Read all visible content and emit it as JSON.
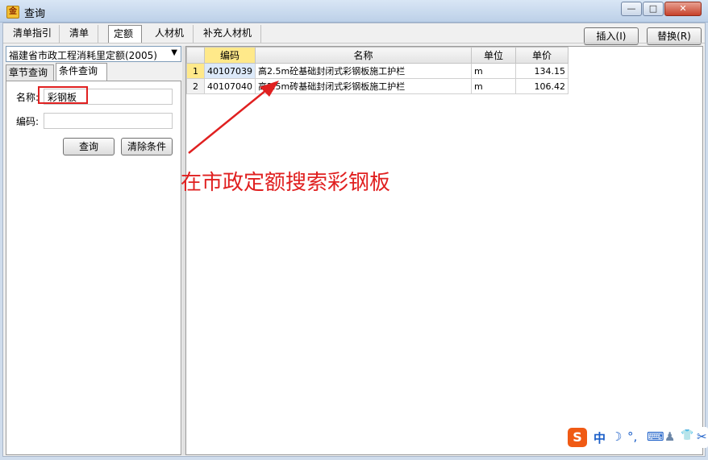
{
  "window": {
    "title": "查询",
    "app_icon": "金",
    "controls": {
      "minimize": "—",
      "maximize": "□",
      "close": "✕"
    }
  },
  "tabs": [
    "清单指引",
    "清单",
    "定额",
    "人材机",
    "补充人材机"
  ],
  "active_tab": "定额",
  "buttons": {
    "insert": "插入(I)",
    "replace": "替换(R)",
    "query": "查询",
    "clear": "清除条件"
  },
  "left": {
    "dropdown_value": "福建省市政工程消耗里定额(2005)",
    "dropdown_arrow": "▼",
    "subtabs": [
      "章节查询",
      "条件查询"
    ],
    "name_label": "名称:",
    "name_value": "彩钢板",
    "code_label": "编码:",
    "code_value": ""
  },
  "grid": {
    "columns": [
      "编码",
      "名称",
      "单位",
      "单价"
    ],
    "rows": [
      {
        "no": "1",
        "code": "40107039",
        "name": "高2.5m砼基础封闭式彩钢板施工护栏",
        "unit": "m",
        "price": "134.15"
      },
      {
        "no": "2",
        "code": "40107040",
        "name": "高2.5m砖基础封闭式彩钢板施工护栏",
        "unit": "m",
        "price": "106.42"
      }
    ]
  },
  "annotation": "在市政定额搜索彩钢板",
  "ime": {
    "logo": "S",
    "lang": "中",
    "moon": "☽",
    "punct": "°,",
    "keyboard": "⌨",
    "person": "♟",
    "shirt": "👕",
    "tools": "✂"
  },
  "colors": {
    "annotation": "#e02020",
    "highlight": "#ffe98a"
  }
}
